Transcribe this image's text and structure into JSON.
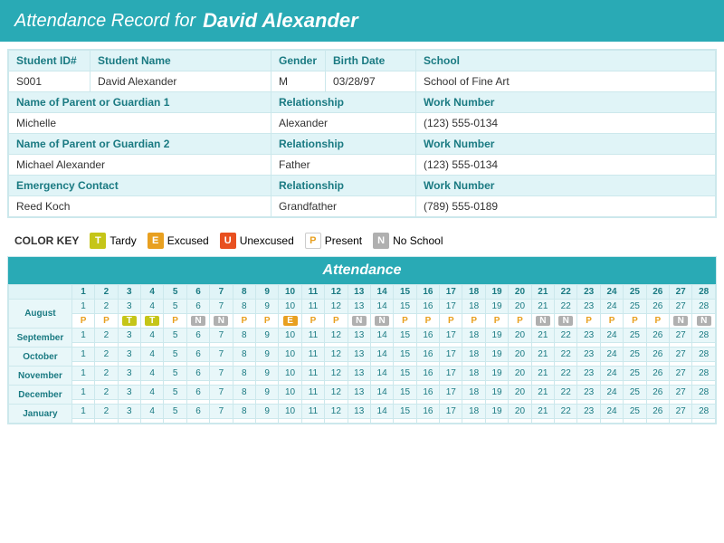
{
  "header": {
    "prefix": "Attendance Record for",
    "student_name": "David Alexander"
  },
  "student_info": {
    "columns": [
      "Student ID#",
      "Student Name",
      "Gender",
      "Birth Date",
      "School"
    ],
    "data": [
      "S001",
      "David Alexander",
      "M",
      "03/28/97",
      "School of Fine Art"
    ]
  },
  "parent1": {
    "label": "Name of Parent or Guardian 1",
    "rel_label": "Relationship",
    "work_label": "Work Number",
    "name": "Michelle",
    "relationship": "Alexander",
    "work": "(123) 555-0134"
  },
  "parent2": {
    "label": "Name of Parent or Guardian 2",
    "rel_label": "Relationship",
    "work_label": "Work Number",
    "name": "Michael Alexander",
    "relationship": "Father",
    "work": "(123) 555-0134"
  },
  "emergency": {
    "label": "Emergency Contact",
    "rel_label": "Relationship",
    "work_label": "Work Number",
    "name": "Reed Koch",
    "relationship": "Grandfather",
    "work": "(789) 555-0189"
  },
  "color_key": {
    "label": "COLOR KEY",
    "items": [
      {
        "code": "T",
        "label": "Tardy",
        "color": "#c5c518"
      },
      {
        "code": "E",
        "label": "Excused",
        "color": "#e8a020"
      },
      {
        "code": "U",
        "label": "Unexcused",
        "color": "#e85020"
      },
      {
        "code": "P",
        "label": "Present",
        "color": "transparent"
      },
      {
        "code": "N",
        "label": "No School",
        "color": "#b0b0b0"
      }
    ]
  },
  "attendance": {
    "title": "Attendance",
    "days": [
      1,
      2,
      3,
      4,
      5,
      6,
      7,
      8,
      9,
      10,
      11,
      12,
      13,
      14,
      15,
      16,
      17,
      18,
      19,
      20,
      21,
      22,
      23,
      24,
      25,
      26,
      27,
      28
    ],
    "months": [
      {
        "name": "August",
        "records": [
          "P",
          "P",
          "T",
          "T",
          "P",
          "N",
          "N",
          "P",
          "P",
          "E",
          "P",
          "P",
          "N",
          "N",
          "P",
          "P",
          "P",
          "P",
          "P",
          "P",
          "N",
          "N",
          "P",
          "P",
          "P",
          "P",
          "N",
          "N"
        ]
      },
      {
        "name": "September",
        "records": []
      },
      {
        "name": "October",
        "records": []
      },
      {
        "name": "November",
        "records": []
      },
      {
        "name": "December",
        "records": []
      },
      {
        "name": "January",
        "records": []
      }
    ]
  }
}
